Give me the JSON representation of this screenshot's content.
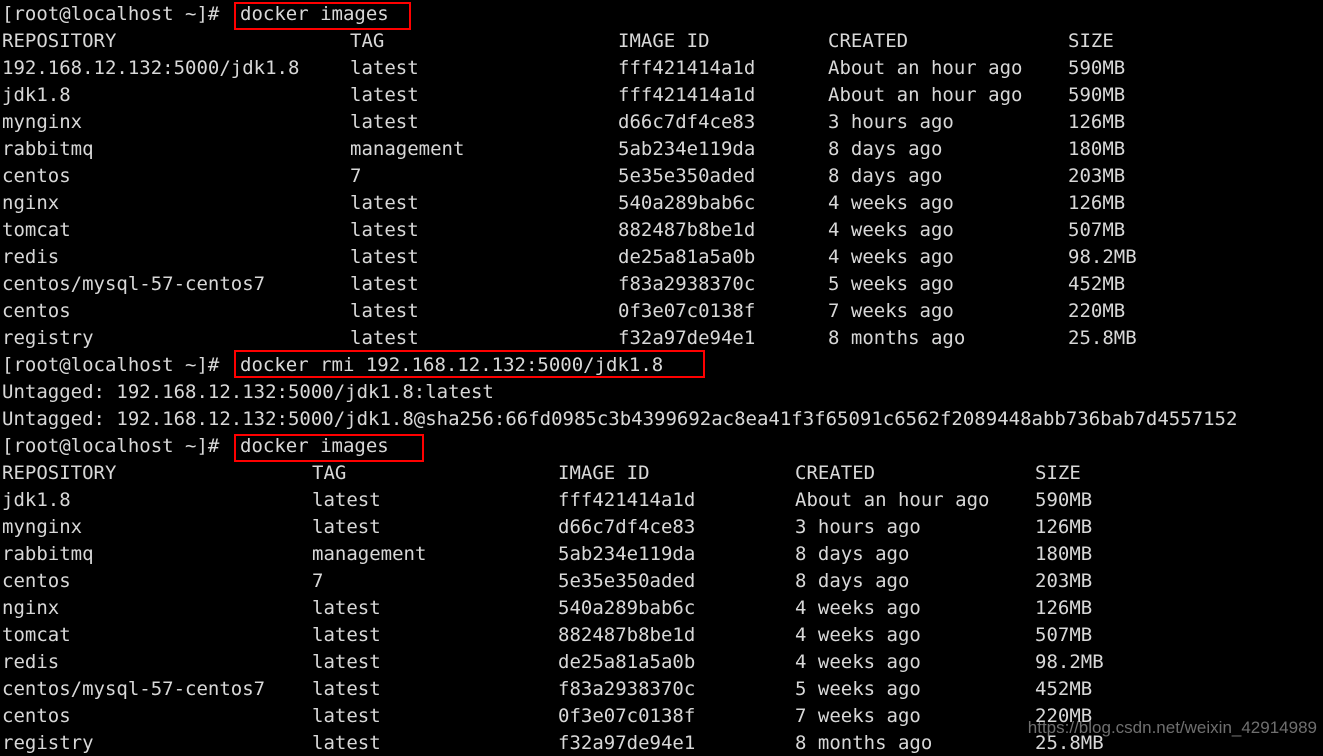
{
  "terminal": {
    "prompt": "[root@localhost ~]# ",
    "colors": {
      "background": "#000000",
      "foreground": "#d8d8d8",
      "highlight_box": "#ff0000",
      "watermark": "#9a9a9a"
    },
    "watermark": "https://blog.csdn.net/weixin_42914989"
  },
  "block1": {
    "command": "docker images",
    "headers": {
      "repository": "REPOSITORY",
      "tag": "TAG",
      "image_id": "IMAGE ID",
      "created": "CREATED",
      "size": "SIZE"
    },
    "rows": [
      {
        "repository": "192.168.12.132:5000/jdk1.8",
        "tag": "latest",
        "image_id": "fff421414a1d",
        "created": "About an hour ago",
        "size": "590MB"
      },
      {
        "repository": "jdk1.8",
        "tag": "latest",
        "image_id": "fff421414a1d",
        "created": "About an hour ago",
        "size": "590MB"
      },
      {
        "repository": "mynginx",
        "tag": "latest",
        "image_id": "d66c7df4ce83",
        "created": "3 hours ago",
        "size": "126MB"
      },
      {
        "repository": "rabbitmq",
        "tag": "management",
        "image_id": "5ab234e119da",
        "created": "8 days ago",
        "size": "180MB"
      },
      {
        "repository": "centos",
        "tag": "7",
        "image_id": "5e35e350aded",
        "created": "8 days ago",
        "size": "203MB"
      },
      {
        "repository": "nginx",
        "tag": "latest",
        "image_id": "540a289bab6c",
        "created": "4 weeks ago",
        "size": "126MB"
      },
      {
        "repository": "tomcat",
        "tag": "latest",
        "image_id": "882487b8be1d",
        "created": "4 weeks ago",
        "size": "507MB"
      },
      {
        "repository": "redis",
        "tag": "latest",
        "image_id": "de25a81a5a0b",
        "created": "4 weeks ago",
        "size": "98.2MB"
      },
      {
        "repository": "centos/mysql-57-centos7",
        "tag": "latest",
        "image_id": "f83a2938370c",
        "created": "5 weeks ago",
        "size": "452MB"
      },
      {
        "repository": "centos",
        "tag": "latest",
        "image_id": "0f3e07c0138f",
        "created": "7 weeks ago",
        "size": "220MB"
      },
      {
        "repository": "registry",
        "tag": "latest",
        "image_id": "f32a97de94e1",
        "created": "8 months ago",
        "size": "25.8MB"
      }
    ]
  },
  "block2": {
    "command": "docker rmi 192.168.12.132:5000/jdk1.8",
    "output": [
      "Untagged: 192.168.12.132:5000/jdk1.8:latest",
      "Untagged: 192.168.12.132:5000/jdk1.8@sha256:66fd0985c3b4399692ac8ea41f3f65091c6562f2089448abb736bab7d4557152"
    ]
  },
  "block3": {
    "command": "docker images",
    "headers": {
      "repository": "REPOSITORY",
      "tag": "TAG",
      "image_id": "IMAGE ID",
      "created": "CREATED",
      "size": "SIZE"
    },
    "rows": [
      {
        "repository": "jdk1.8",
        "tag": "latest",
        "image_id": "fff421414a1d",
        "created": "About an hour ago",
        "size": "590MB"
      },
      {
        "repository": "mynginx",
        "tag": "latest",
        "image_id": "d66c7df4ce83",
        "created": "3 hours ago",
        "size": "126MB"
      },
      {
        "repository": "rabbitmq",
        "tag": "management",
        "image_id": "5ab234e119da",
        "created": "8 days ago",
        "size": "180MB"
      },
      {
        "repository": "centos",
        "tag": "7",
        "image_id": "5e35e350aded",
        "created": "8 days ago",
        "size": "203MB"
      },
      {
        "repository": "nginx",
        "tag": "latest",
        "image_id": "540a289bab6c",
        "created": "4 weeks ago",
        "size": "126MB"
      },
      {
        "repository": "tomcat",
        "tag": "latest",
        "image_id": "882487b8be1d",
        "created": "4 weeks ago",
        "size": "507MB"
      },
      {
        "repository": "redis",
        "tag": "latest",
        "image_id": "de25a81a5a0b",
        "created": "4 weeks ago",
        "size": "98.2MB"
      },
      {
        "repository": "centos/mysql-57-centos7",
        "tag": "latest",
        "image_id": "f83a2938370c",
        "created": "5 weeks ago",
        "size": "452MB"
      },
      {
        "repository": "centos",
        "tag": "latest",
        "image_id": "0f3e07c0138f",
        "created": "7 weeks ago",
        "size": "220MB"
      },
      {
        "repository": "registry",
        "tag": "latest",
        "image_id": "f32a97de94e1",
        "created": "8 months ago",
        "size": "25.8MB"
      }
    ]
  }
}
